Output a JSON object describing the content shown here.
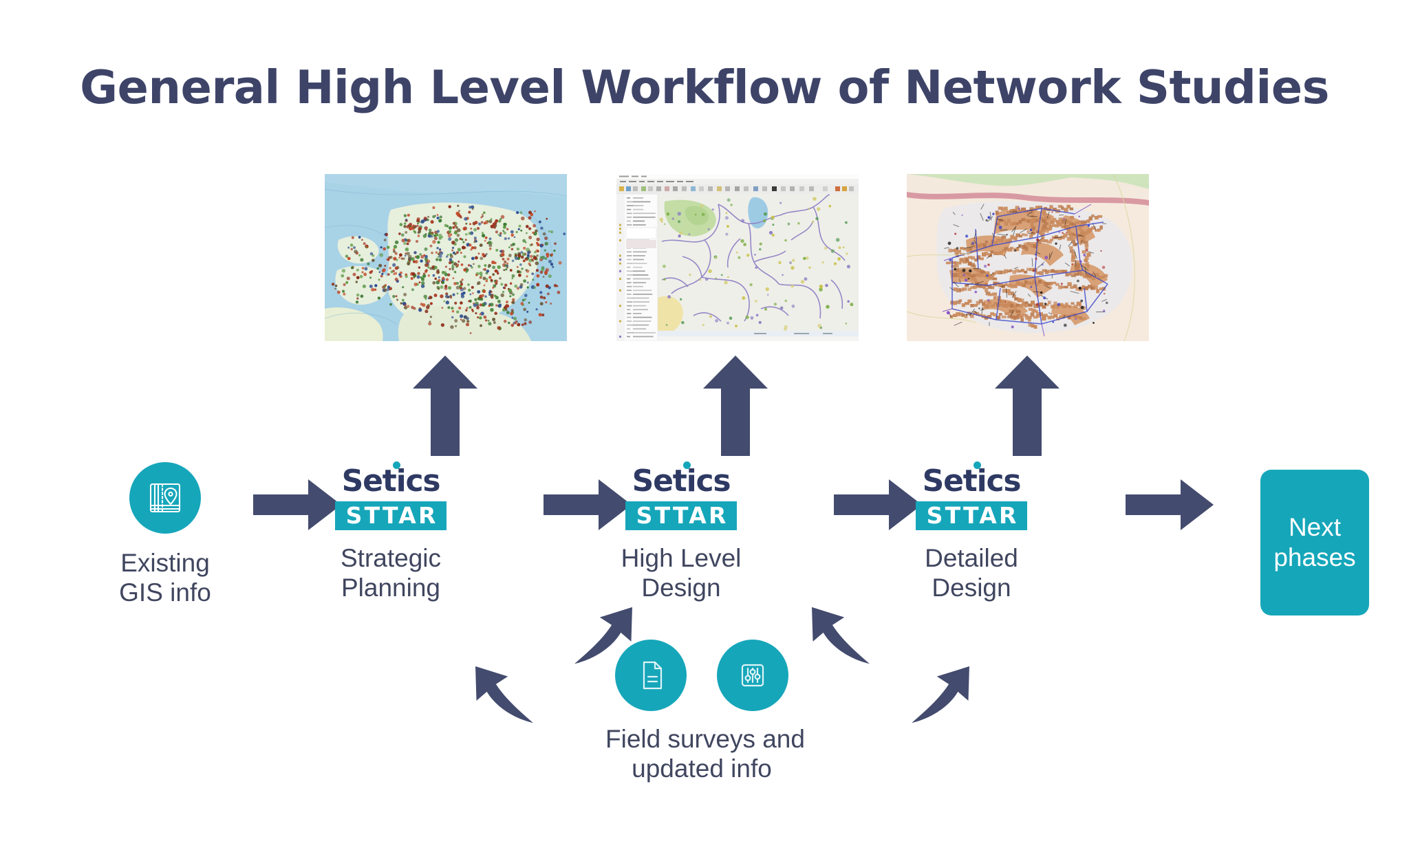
{
  "title": "General High Level Workflow of Network Studies",
  "colors": {
    "navy": "#3e4468",
    "arrow_navy": "#434b6e",
    "teal": "#16a6ba",
    "text": "#40465f",
    "white": "#ffffff"
  },
  "stages": {
    "gis": {
      "icon": "map-book-pin-icon",
      "label": "Existing\nGIS info",
      "label_line1": "Existing",
      "label_line2": "GIS info"
    },
    "strategic": {
      "logo_top": "Setics",
      "logo_bottom": "STTAR",
      "label_line1": "Strategic",
      "label_line2": "Planning"
    },
    "high_level": {
      "logo_top": "Setics",
      "logo_bottom": "STTAR",
      "label_line1": "High Level",
      "label_line2": "Design"
    },
    "detailed": {
      "logo_top": "Setics",
      "logo_bottom": "STTAR",
      "label_line1": "Detailed",
      "label_line2": "Design"
    },
    "next": {
      "label_line1": "Next",
      "label_line2": "phases"
    }
  },
  "feedback": {
    "icon_document": "document-icon",
    "icon_sliders": "sliders-icon",
    "label_line1": "Field surveys and",
    "label_line2": "updated info"
  },
  "thumbnails": [
    {
      "name": "regional-coverage-map",
      "description": "Regional map with water and scattered colored point markers"
    },
    {
      "name": "gis-application-network-map",
      "description": "GIS desktop application window with layer panel and purple network routes"
    },
    {
      "name": "detailed-urban-network-map",
      "description": "Detailed urban plan with building footprints and fibre network lines"
    }
  ],
  "arrows": {
    "up": [
      "up-arrow-1",
      "up-arrow-2",
      "up-arrow-3"
    ],
    "right": [
      "right-arrow-1",
      "right-arrow-2",
      "right-arrow-3",
      "right-arrow-4"
    ],
    "curved": [
      "curve-arrow-left-outer",
      "curve-arrow-left-inner",
      "curve-arrow-right-inner",
      "curve-arrow-right-outer"
    ]
  }
}
